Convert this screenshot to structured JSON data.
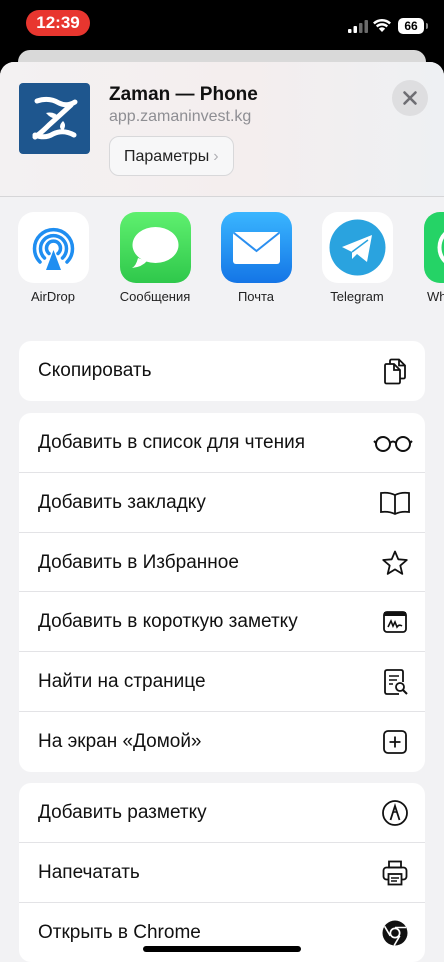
{
  "status_bar": {
    "time": "12:39",
    "battery": "66"
  },
  "header": {
    "title": "Zaman — Phone",
    "url": "app.zamaninvest.kg",
    "options_label": "Параметры",
    "options_chevron": "›"
  },
  "apps": [
    {
      "label": "AirDrop",
      "icon": "airdrop-icon"
    },
    {
      "label": "Сообщения",
      "icon": "messages-icon"
    },
    {
      "label": "Почта",
      "icon": "mail-icon"
    },
    {
      "label": "Telegram",
      "icon": "telegram-icon"
    },
    {
      "label": "Wh",
      "icon": "whatsapp-icon"
    }
  ],
  "group1": [
    {
      "label": "Скопировать",
      "icon": "copy-icon"
    }
  ],
  "group2": [
    {
      "label": "Добавить в список для чтения",
      "icon": "glasses-icon"
    },
    {
      "label": "Добавить закладку",
      "icon": "book-icon"
    },
    {
      "label": "Добавить в Избранное",
      "icon": "star-icon"
    },
    {
      "label": "Добавить в короткую заметку",
      "icon": "quick-note-icon"
    },
    {
      "label": "Найти на странице",
      "icon": "find-in-page-icon"
    },
    {
      "label": "На экран «Домой»",
      "icon": "add-square-icon"
    }
  ],
  "group3": [
    {
      "label": "Добавить разметку",
      "icon": "markup-icon"
    },
    {
      "label": "Напечатать",
      "icon": "printer-icon"
    },
    {
      "label": "Открыть в Chrome",
      "icon": "chrome-icon"
    }
  ],
  "colors": {
    "accent_red": "#e8362f",
    "brand_blue": "#1e568e",
    "messages_green": "#34c759",
    "mail_blue": "#1f8ef1",
    "telegram_blue": "#2aa3df",
    "whatsapp_green": "#25d366"
  }
}
